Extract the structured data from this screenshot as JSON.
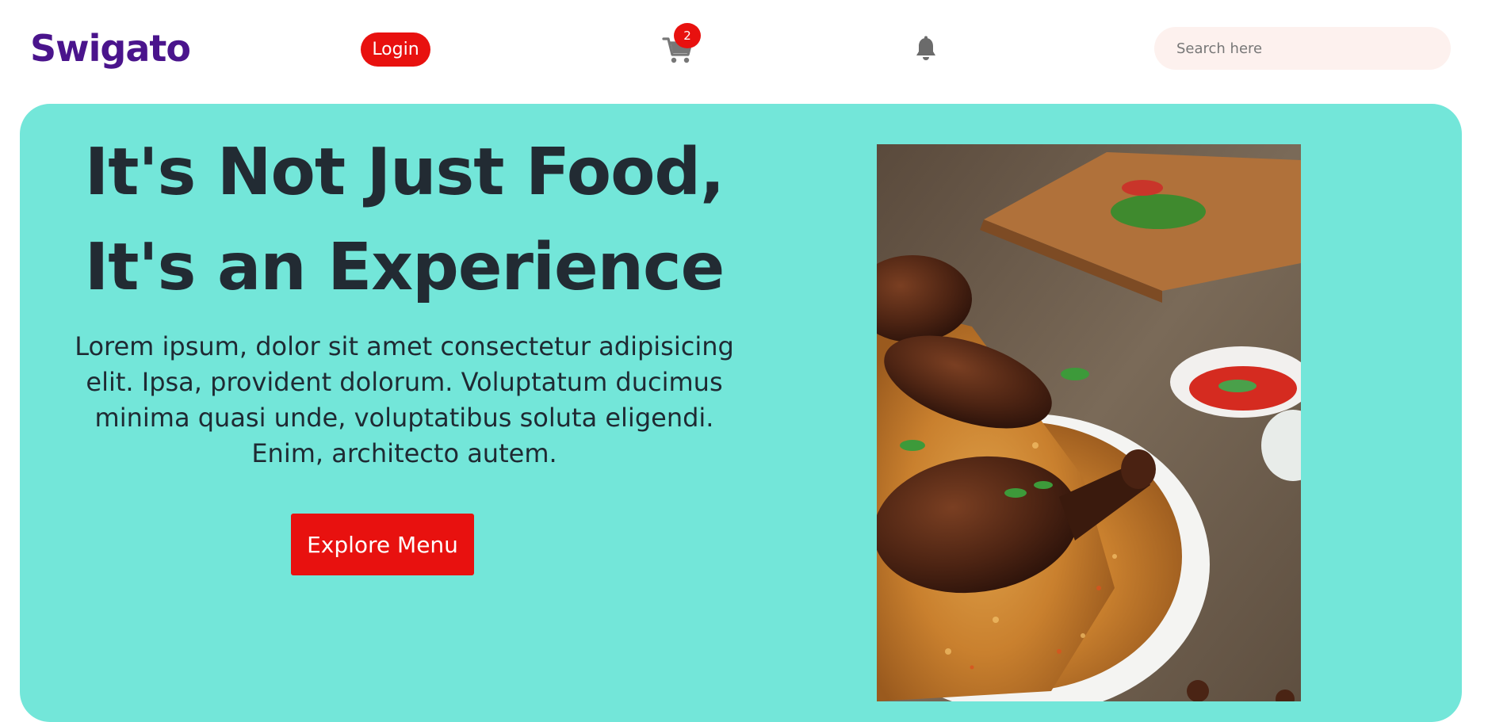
{
  "header": {
    "logo": "Swigato",
    "login_label": "Login",
    "cart_count": "2",
    "search_placeholder": "Search here",
    "search_value": ""
  },
  "hero": {
    "headline_line1": "It's Not Just Food,",
    "headline_line2": "It's an Experience",
    "description": "Lorem ipsum, dolor sit amet consectetur adipisicing elit. Ipsa, provident dolorum. Voluptatum ducimus minima quasi unde, voluptatibus soluta eligendi. Enim, architecto autem.",
    "cta_label": "Explore Menu",
    "image_icon": "biryani-food-image"
  },
  "colors": {
    "brand": "#4a148c",
    "accent": "#e8110f",
    "hero_bg": "#73e6d9",
    "search_bg": "#fdf1ee",
    "text_dark": "#222b33"
  }
}
